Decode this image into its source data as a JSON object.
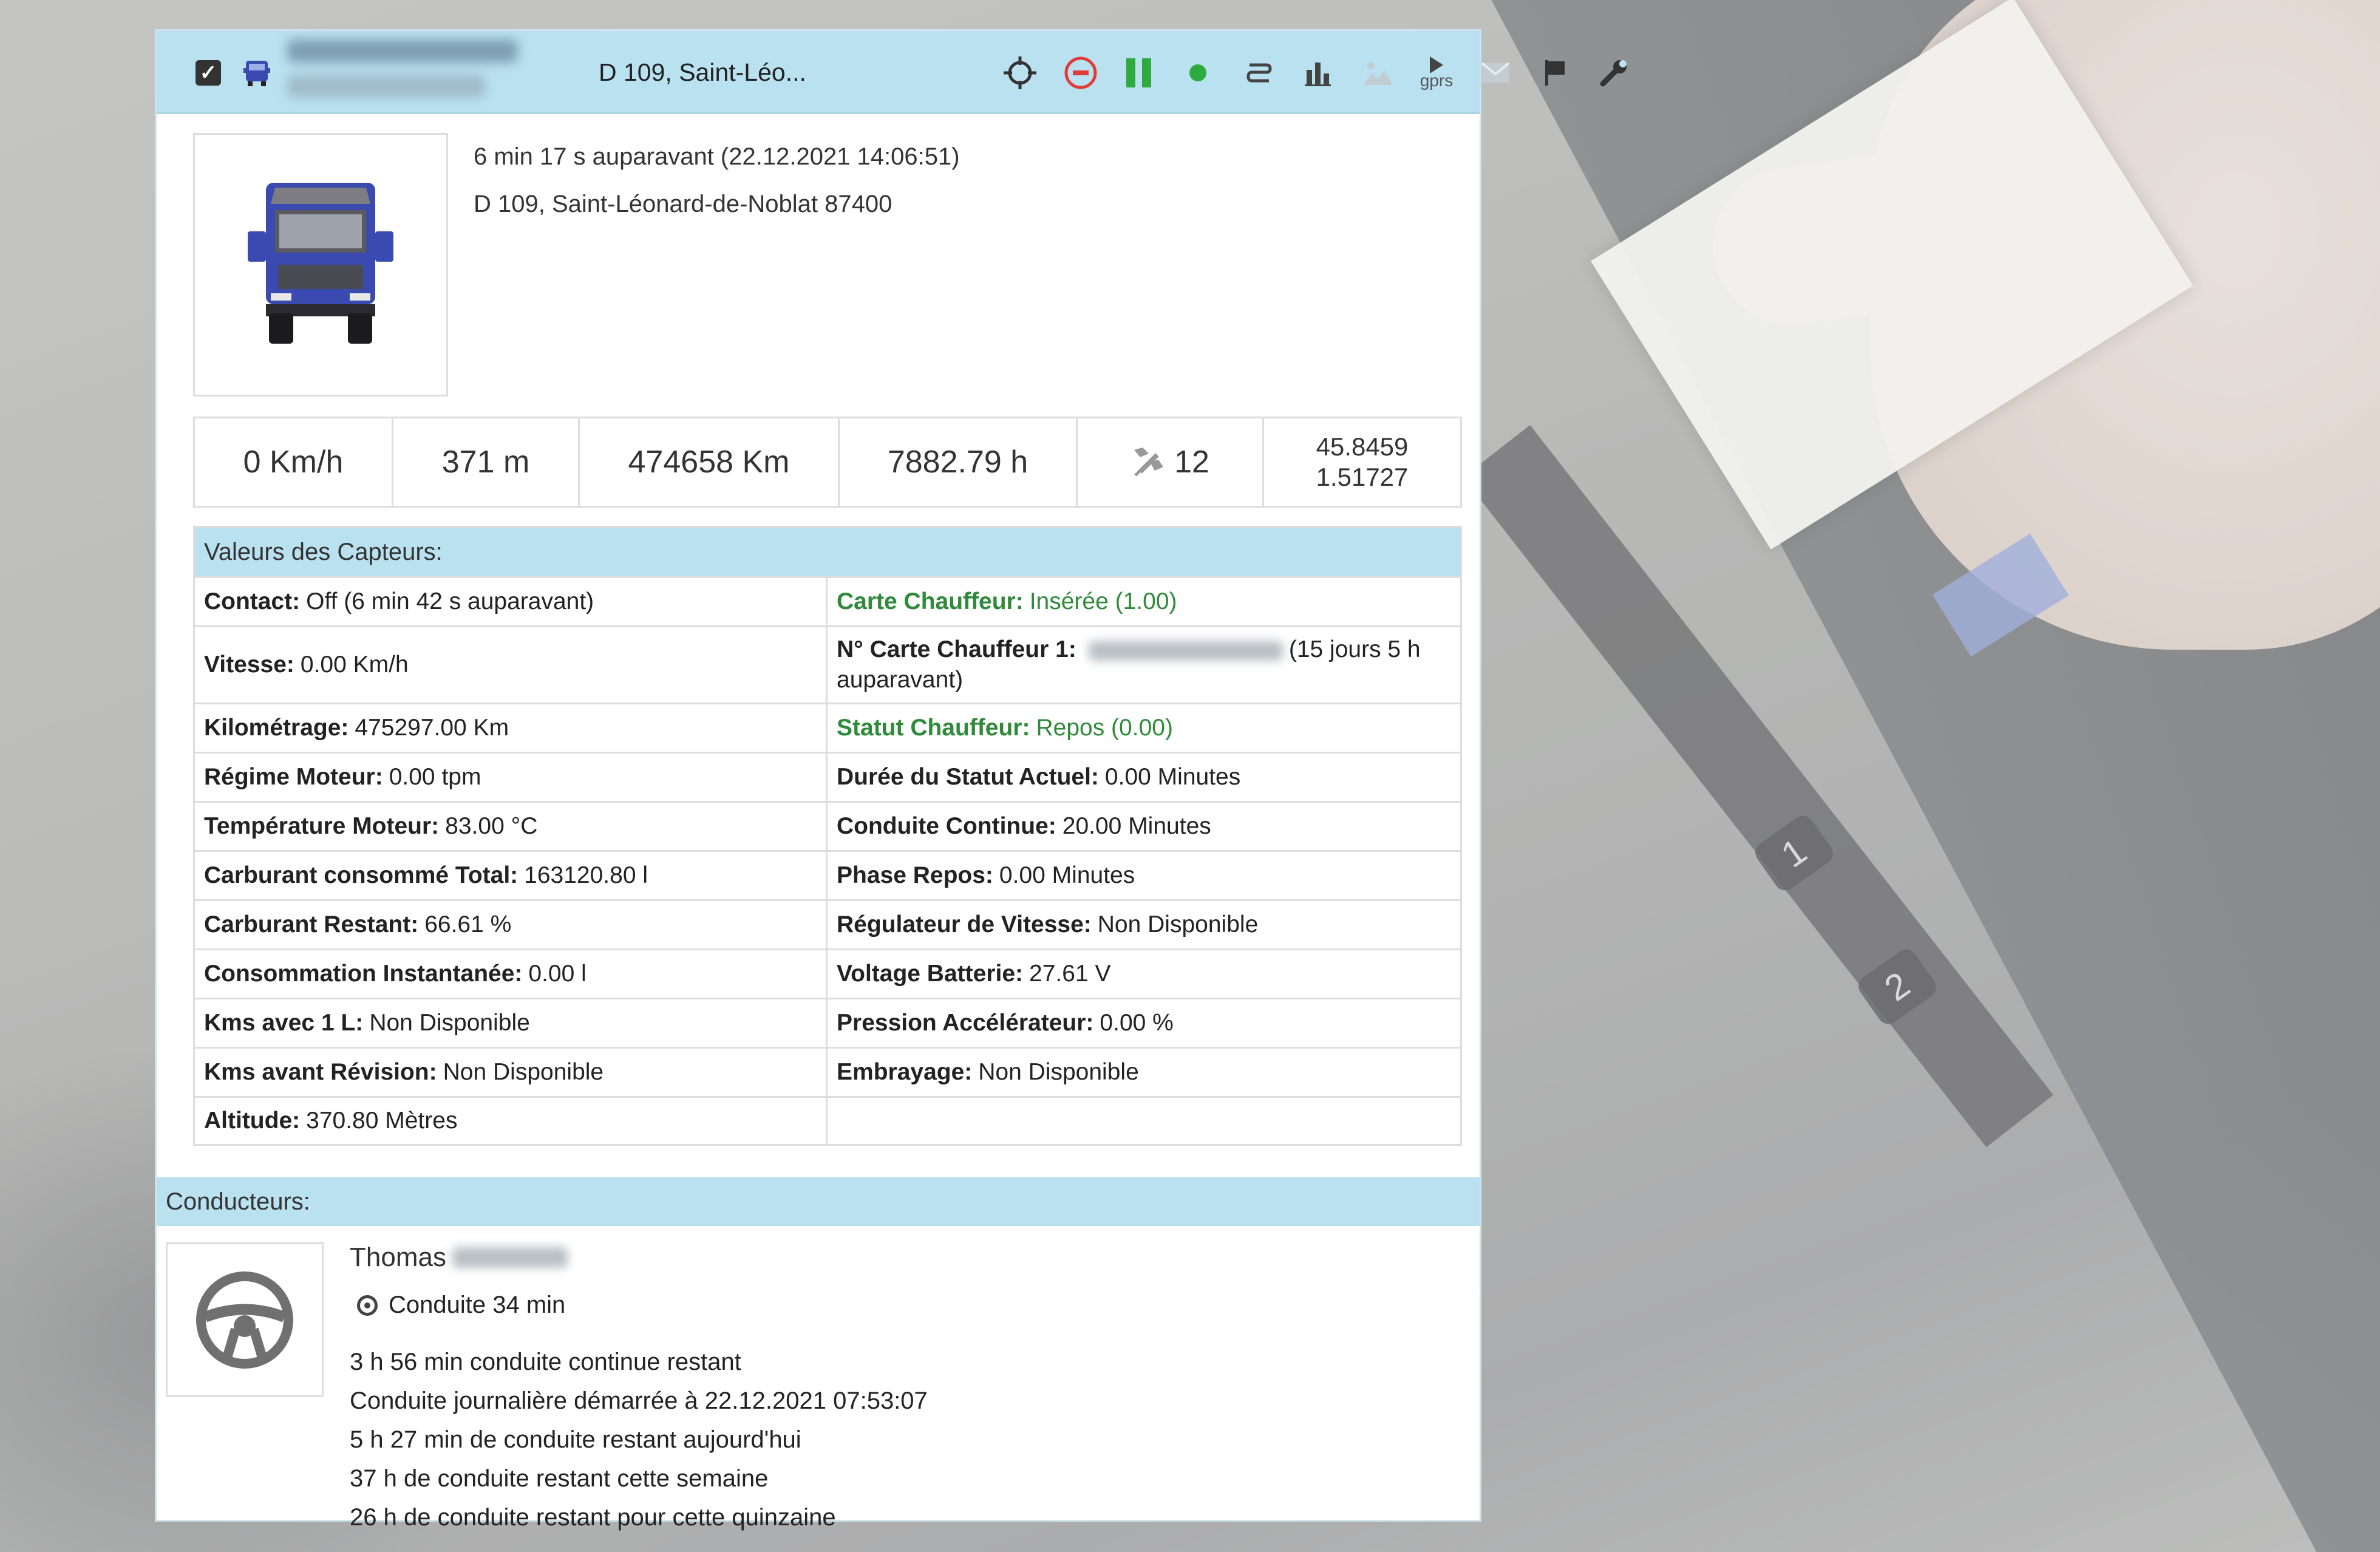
{
  "toolbar": {
    "address": "D 109, Saint-Léo...",
    "gprs_label": "gprs",
    "icons": [
      "checkbox-icon",
      "truck-icon",
      "crosshair-icon",
      "stop-icon",
      "pause-icon",
      "online-dot-icon",
      "route-icon",
      "bar-chart-icon",
      "image-icon",
      "gprs-play-icon",
      "message-icon",
      "flag-icon",
      "wrench-icon"
    ]
  },
  "summary": {
    "time_ago": "6 min 17 s auparavant (22.12.2021 14:06:51)",
    "address": "D 109, Saint-Léonard-de-Noblat 87400"
  },
  "stats": {
    "speed": "0 Km/h",
    "altitude": "371 m",
    "mileage": "474658 Km",
    "engine_hours": "7882.79 h",
    "satellites": "12",
    "lat": "45.8459",
    "lon": "1.51727"
  },
  "sensors": {
    "title": "Valeurs des Capteurs:",
    "rows": [
      [
        {
          "label": "Contact:",
          "value": "Off (6 min  42 s auparavant)"
        },
        {
          "label": "Carte Chauffeur:",
          "value": "Insérée (1.00)"
        }
      ],
      [
        {
          "label": "Vitesse:",
          "value": "0.00 Km/h"
        },
        {
          "label": "N° Carte Chauffeur 1:",
          "value": "(15 jours 5 h auparavant)"
        }
      ],
      [
        {
          "label": "Kilométrage:",
          "value": "475297.00 Km"
        },
        {
          "label": "Statut Chauffeur:",
          "value": "Repos (0.00)"
        }
      ],
      [
        {
          "label": "Régime Moteur:",
          "value": "0.00 tpm"
        },
        {
          "label": "Durée du Statut Actuel:",
          "value": "0.00 Minutes"
        }
      ],
      [
        {
          "label": "Température Moteur:",
          "value": "83.00 °C"
        },
        {
          "label": "Conduite Continue:",
          "value": "20.00 Minutes"
        }
      ],
      [
        {
          "label": "Carburant consommé Total:",
          "value": "163120.80 l"
        },
        {
          "label": "Phase Repos:",
          "value": "0.00 Minutes"
        }
      ],
      [
        {
          "label": "Carburant Restant:",
          "value": "66.61 %"
        },
        {
          "label": "Régulateur de Vitesse:",
          "value": "Non Disponible"
        }
      ],
      [
        {
          "label": "Consommation Instantanée:",
          "value": "0.00 l"
        },
        {
          "label": "Voltage Batterie:",
          "value": "27.61 V"
        }
      ],
      [
        {
          "label": "Kms avec 1 L:",
          "value": "Non Disponible"
        },
        {
          "label": "Pression Accélérateur:",
          "value": "0.00 %"
        }
      ],
      [
        {
          "label": "Kms avant Révision:",
          "value": "Non Disponible"
        },
        {
          "label": "Embrayage:",
          "value": "Non Disponible"
        }
      ],
      [
        {
          "label": "Altitude:",
          "value": "370.80 Mètres"
        },
        {
          "label": "",
          "value": ""
        }
      ]
    ]
  },
  "drivers": {
    "title": "Conducteurs:",
    "first_name": "Thomas",
    "status": "Conduite 34 min",
    "lines": [
      "3 h 56 min  conduite continue restant",
      "Conduite journalière démarrée à 22.12.2021 07:53:07",
      "5 h 27 min  de conduite restant aujourd'hui",
      "37 h de conduite restant cette semaine",
      "26 h de conduite restant pour cette quinzaine"
    ]
  },
  "background": {
    "buttons": [
      "1",
      "2"
    ]
  },
  "colors": {
    "header_bg": "#b9e1ef",
    "green_status": "#2f8a3a",
    "truck_blue": "#3a4ab0",
    "stop_red": "#e23b3b",
    "pause_green": "#2faa3f"
  }
}
